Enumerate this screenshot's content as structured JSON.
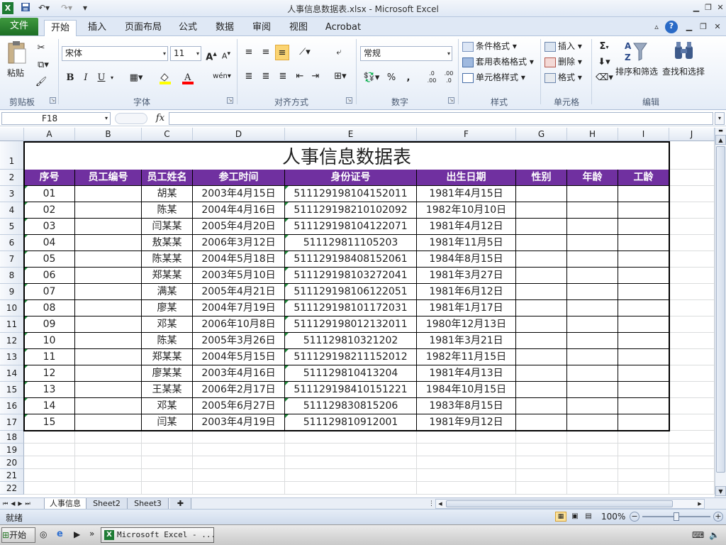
{
  "window": {
    "title": "人事信息数据表.xlsx  -  Microsoft Excel"
  },
  "quick_access": {
    "save_icon": "save-icon",
    "undo_icon": "undo-icon",
    "redo_icon": "redo-icon",
    "customize": "▾"
  },
  "ribbon_tabs": [
    "文件",
    "开始",
    "插入",
    "页面布局",
    "公式",
    "数据",
    "审阅",
    "视图",
    "Acrobat"
  ],
  "active_tab": "开始",
  "ribbon": {
    "clipboard": {
      "paste": "粘贴",
      "label": "剪贴板"
    },
    "font": {
      "name": "宋体",
      "size": "11",
      "grow": "A",
      "shrink": "A",
      "bold": "B",
      "italic": "I",
      "underline": "U",
      "wen": "wén",
      "label": "字体",
      "fill_color": "#ffff00",
      "font_color": "#ff0000"
    },
    "alignment": {
      "label": "对齐方式"
    },
    "number": {
      "format": "常规",
      "percent": "%",
      "comma": ",",
      "inc_dec": ".0 .00",
      "dec_dec": ".00 .0",
      "label": "数字"
    },
    "styles": {
      "conditional": "条件格式",
      "table": "套用表格格式",
      "cell_style": "单元格样式",
      "label": "样式"
    },
    "cells": {
      "insert": "插入",
      "delete": "删除",
      "format": "格式",
      "label": "单元格"
    },
    "editing": {
      "sum": "Σ",
      "sort_filter": "排序和筛选",
      "find_select": "查找和选择",
      "label": "编辑"
    }
  },
  "formula_bar": {
    "name_box": "F18",
    "fx": "fx",
    "value": ""
  },
  "columns": [
    "A",
    "B",
    "C",
    "D",
    "E",
    "F",
    "G",
    "H",
    "I",
    "J"
  ],
  "rows": [
    "1",
    "2",
    "3",
    "4",
    "5",
    "6",
    "7",
    "8",
    "9",
    "10",
    "11",
    "12",
    "13",
    "14",
    "15",
    "16",
    "17",
    "18",
    "19",
    "20",
    "21",
    "22"
  ],
  "table": {
    "title": "人事信息数据表",
    "header_color": "#7030a0",
    "headers": [
      "序号",
      "员工编号",
      "员工姓名",
      "参工时间",
      "身份证号",
      "出生日期",
      "性别",
      "年龄",
      "工龄"
    ],
    "data": [
      [
        "01",
        "",
        "胡某",
        "2003年4月15日",
        "511129198104152011",
        "1981年4月15日",
        "",
        "",
        ""
      ],
      [
        "02",
        "",
        "陈某",
        "2004年4月16日",
        "511129198210102092",
        "1982年10月10日",
        "",
        "",
        ""
      ],
      [
        "03",
        "",
        "闫某某",
        "2005年4月20日",
        "511129198104122071",
        "1981年4月12日",
        "",
        "",
        ""
      ],
      [
        "04",
        "",
        "敖某某",
        "2006年3月12日",
        "511129811105203",
        "1981年11月5日",
        "",
        "",
        ""
      ],
      [
        "05",
        "",
        "陈某某",
        "2004年5月18日",
        "511129198408152061",
        "1984年8月15日",
        "",
        "",
        ""
      ],
      [
        "06",
        "",
        "郑某某",
        "2003年5月10日",
        "511129198103272041",
        "1981年3月27日",
        "",
        "",
        ""
      ],
      [
        "07",
        "",
        "满某",
        "2005年4月21日",
        "511129198106122051",
        "1981年6月12日",
        "",
        "",
        ""
      ],
      [
        "08",
        "",
        "廖某",
        "2004年7月19日",
        "511129198101172031",
        "1981年1月17日",
        "",
        "",
        ""
      ],
      [
        "09",
        "",
        "邓某",
        "2006年10月8日",
        "511129198012132011",
        "1980年12月13日",
        "",
        "",
        ""
      ],
      [
        "10",
        "",
        "陈某",
        "2005年3月26日",
        "511129810321202",
        "1981年3月21日",
        "",
        "",
        ""
      ],
      [
        "11",
        "",
        "郑某某",
        "2004年5月15日",
        "511129198211152012",
        "1982年11月15日",
        "",
        "",
        ""
      ],
      [
        "12",
        "",
        "廖某某",
        "2003年4月16日",
        "511129810413204",
        "1981年4月13日",
        "",
        "",
        ""
      ],
      [
        "13",
        "",
        "王某某",
        "2006年2月17日",
        "511129198410151221",
        "1984年10月15日",
        "",
        "",
        ""
      ],
      [
        "14",
        "",
        "邓某",
        "2005年6月27日",
        "511129830815206",
        "1983年8月15日",
        "",
        "",
        ""
      ],
      [
        "15",
        "",
        "闫某",
        "2003年4月19日",
        "511129810912001",
        "1981年9月12日",
        "",
        "",
        ""
      ]
    ]
  },
  "sheet_tabs": [
    "人事信息",
    "Sheet2",
    "Sheet3"
  ],
  "active_sheet": "人事信息",
  "status": {
    "ready": "就绪",
    "zoom": "100%"
  },
  "taskbar": {
    "start": "开始",
    "excel_task": "Microsoft Excel - ...",
    "more": "»"
  }
}
